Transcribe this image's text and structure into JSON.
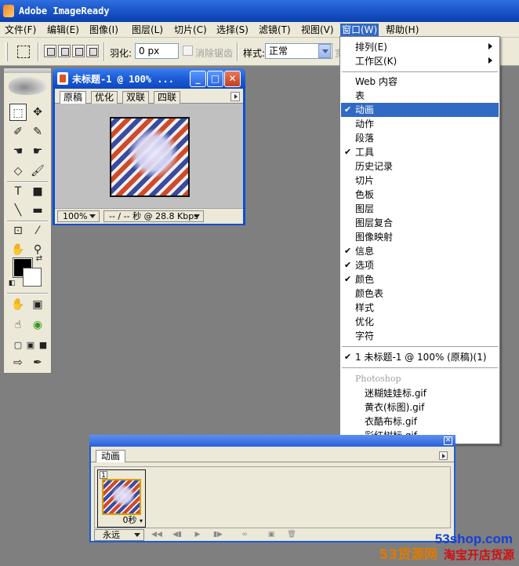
{
  "window": {
    "title": "Adobe ImageReady"
  },
  "menubar": {
    "items": [
      {
        "label": "文件(F)"
      },
      {
        "label": "编辑(E)"
      },
      {
        "label": "图像(I)"
      },
      {
        "label": "图层(L)"
      },
      {
        "label": "切片(C)"
      },
      {
        "label": "选择(S)"
      },
      {
        "label": "滤镜(T)"
      },
      {
        "label": "视图(V)"
      },
      {
        "label": "窗口(W)"
      },
      {
        "label": "帮助(H)"
      }
    ],
    "active_index": 8
  },
  "optionsbar": {
    "feather_label": "羽化:",
    "feather_value": "0 px",
    "antialias_label": "消除锯齿",
    "style_label": "样式:",
    "style_value": "正常",
    "width_label": "宽"
  },
  "document": {
    "title": "未标题-1 @ 100% ...",
    "tabs": [
      "原稿",
      "优化",
      "双联",
      "四联"
    ],
    "active_tab": 0,
    "zoom": "100%",
    "download_info": "-- / -- 秒 @ 28.8 Kbps"
  },
  "window_menu": {
    "top_items": [
      {
        "label": "排列(E)",
        "submenu": true
      },
      {
        "label": "工作区(K)",
        "submenu": true
      }
    ],
    "palettes": [
      {
        "label": "Web 内容",
        "checked": false
      },
      {
        "label": "表",
        "checked": false
      },
      {
        "label": "动画",
        "checked": true,
        "highlight": true
      },
      {
        "label": "动作",
        "checked": false
      },
      {
        "label": "段落",
        "checked": false
      },
      {
        "label": "工具",
        "checked": true
      },
      {
        "label": "历史记录",
        "checked": false
      },
      {
        "label": "切片",
        "checked": false
      },
      {
        "label": "色板",
        "checked": false
      },
      {
        "label": "图层",
        "checked": false
      },
      {
        "label": "图层复合",
        "checked": false
      },
      {
        "label": "图像映射",
        "checked": false
      },
      {
        "label": "信息",
        "checked": true
      },
      {
        "label": "选项",
        "checked": true
      },
      {
        "label": "颜色",
        "checked": true
      },
      {
        "label": "颜色表",
        "checked": false
      },
      {
        "label": "样式",
        "checked": false
      },
      {
        "label": "优化",
        "checked": false
      },
      {
        "label": "字符",
        "checked": false
      }
    ],
    "open_documents": [
      {
        "label": "1 未标题-1 @ 100% (原稿)(1)",
        "checked": true
      }
    ],
    "photoshop_header": "Photoshop",
    "photoshop_documents": [
      {
        "label": "迷糊娃娃标.gif"
      },
      {
        "label": "黄衣(标图).gif"
      },
      {
        "label": "衣酷布标.gif"
      },
      {
        "label": "彩红树标.gif"
      }
    ]
  },
  "animation_palette": {
    "tab_label": "动画",
    "frame_number": "1",
    "frame_delay": "0秒",
    "loop_value": "永远"
  },
  "watermark": {
    "brand": "53货源网",
    "slogan": "淘宝开店货源",
    "url_prefix": "53shop",
    "url_suffix": ".com"
  },
  "colors": {
    "xp_blue": "#0a4fd0",
    "menu_highlight": "#316ac5",
    "workspace": "#7f7f7f",
    "chrome": "#ece9d8"
  }
}
